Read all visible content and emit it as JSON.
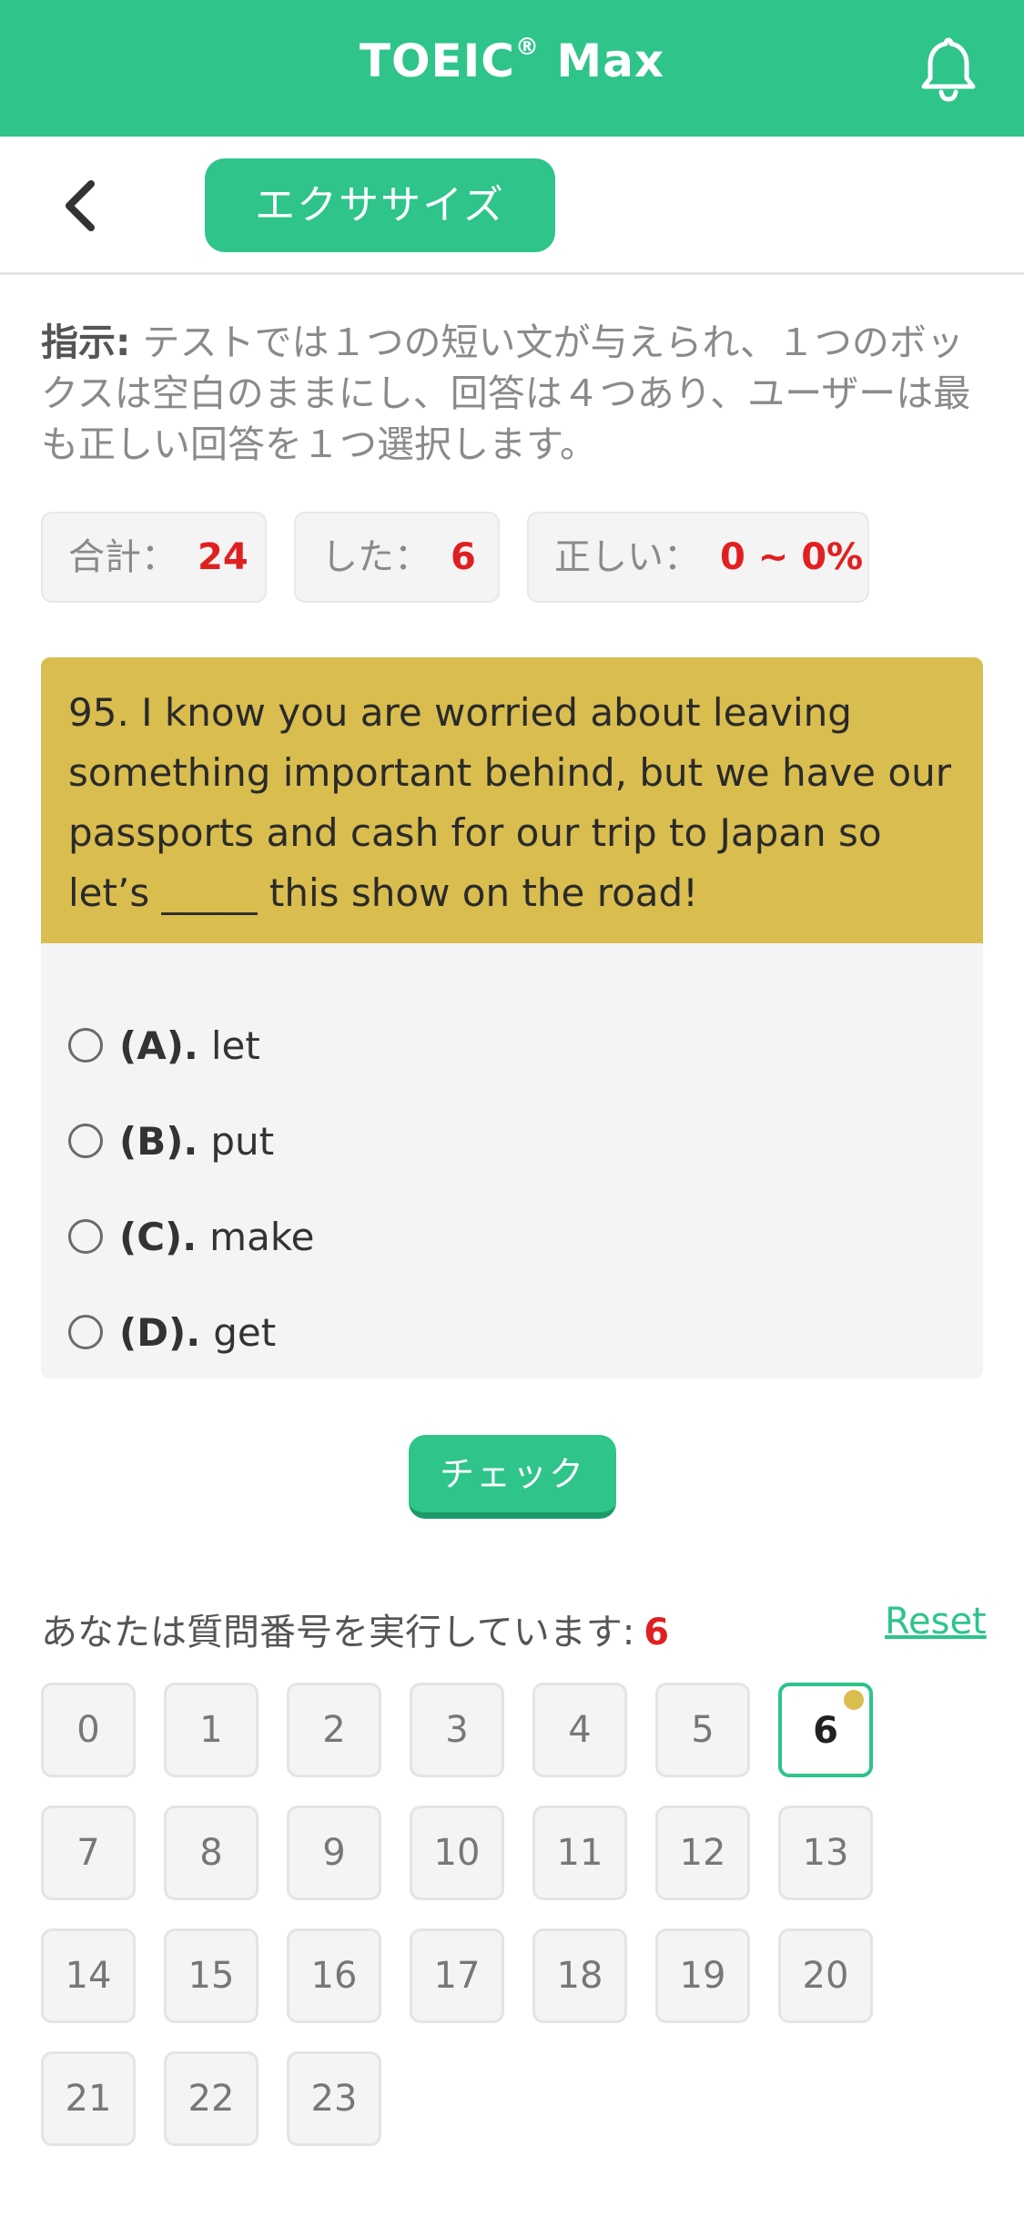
{
  "app": {
    "title": "TOEIC",
    "title_mark": "®",
    "title_suffix": " Max"
  },
  "subbar": {
    "mode_label": "エクササイズ"
  },
  "instructions": {
    "label": "指示:",
    "text": " テストでは１つの短い文が与えられ、１つのボックスは空白のままにし、回答は４つあり、ユーザーは最も正しい回答を１つ選択します。"
  },
  "stats": [
    {
      "label": "合計：",
      "value": "24"
    },
    {
      "label": "した：",
      "value": "6"
    },
    {
      "label": "正しい：",
      "value": "0 ~ 0%"
    }
  ],
  "question": {
    "text": "95. I know you are worried about leaving something important behind, but we have our passports and cash for our trip to Japan so let’s _____ this show on the road!"
  },
  "options": [
    {
      "key": "(A).",
      "text": "let"
    },
    {
      "key": "(B).",
      "text": "put"
    },
    {
      "key": "(C).",
      "text": "make"
    },
    {
      "key": "(D).",
      "text": "get"
    }
  ],
  "check_label": "チェック",
  "progress": {
    "label": "あなたは質問番号を実行しています:",
    "current": "6",
    "reset_label": "Reset"
  },
  "question_numbers": [
    "0",
    "1",
    "2",
    "3",
    "4",
    "5",
    "6",
    "7",
    "8",
    "9",
    "10",
    "11",
    "12",
    "13",
    "14",
    "15",
    "16",
    "17",
    "18",
    "19",
    "20",
    "21",
    "22",
    "23"
  ],
  "colors": {
    "accent": "#2ec48a",
    "question_bg": "#d9bd4e",
    "highlight": "#e02020"
  },
  "icons": {
    "bell": "bell-icon",
    "back": "chevron-left-icon"
  }
}
